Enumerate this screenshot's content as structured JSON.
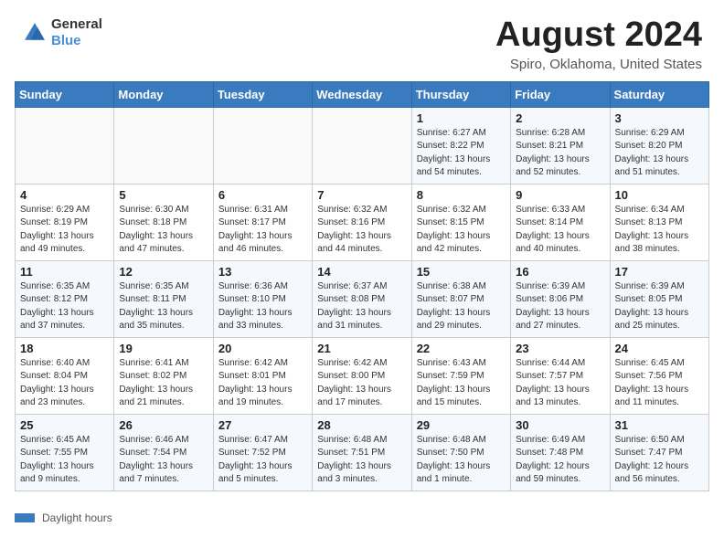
{
  "header": {
    "logo_general": "General",
    "logo_blue": "Blue",
    "month_year": "August 2024",
    "location": "Spiro, Oklahoma, United States"
  },
  "weekdays": [
    "Sunday",
    "Monday",
    "Tuesday",
    "Wednesday",
    "Thursday",
    "Friday",
    "Saturday"
  ],
  "legend": {
    "label": "Daylight hours"
  },
  "weeks": [
    [
      {
        "day": "",
        "info": ""
      },
      {
        "day": "",
        "info": ""
      },
      {
        "day": "",
        "info": ""
      },
      {
        "day": "",
        "info": ""
      },
      {
        "day": "1",
        "info": "Sunrise: 6:27 AM\nSunset: 8:22 PM\nDaylight: 13 hours and 54 minutes."
      },
      {
        "day": "2",
        "info": "Sunrise: 6:28 AM\nSunset: 8:21 PM\nDaylight: 13 hours and 52 minutes."
      },
      {
        "day": "3",
        "info": "Sunrise: 6:29 AM\nSunset: 8:20 PM\nDaylight: 13 hours and 51 minutes."
      }
    ],
    [
      {
        "day": "4",
        "info": "Sunrise: 6:29 AM\nSunset: 8:19 PM\nDaylight: 13 hours and 49 minutes."
      },
      {
        "day": "5",
        "info": "Sunrise: 6:30 AM\nSunset: 8:18 PM\nDaylight: 13 hours and 47 minutes."
      },
      {
        "day": "6",
        "info": "Sunrise: 6:31 AM\nSunset: 8:17 PM\nDaylight: 13 hours and 46 minutes."
      },
      {
        "day": "7",
        "info": "Sunrise: 6:32 AM\nSunset: 8:16 PM\nDaylight: 13 hours and 44 minutes."
      },
      {
        "day": "8",
        "info": "Sunrise: 6:32 AM\nSunset: 8:15 PM\nDaylight: 13 hours and 42 minutes."
      },
      {
        "day": "9",
        "info": "Sunrise: 6:33 AM\nSunset: 8:14 PM\nDaylight: 13 hours and 40 minutes."
      },
      {
        "day": "10",
        "info": "Sunrise: 6:34 AM\nSunset: 8:13 PM\nDaylight: 13 hours and 38 minutes."
      }
    ],
    [
      {
        "day": "11",
        "info": "Sunrise: 6:35 AM\nSunset: 8:12 PM\nDaylight: 13 hours and 37 minutes."
      },
      {
        "day": "12",
        "info": "Sunrise: 6:35 AM\nSunset: 8:11 PM\nDaylight: 13 hours and 35 minutes."
      },
      {
        "day": "13",
        "info": "Sunrise: 6:36 AM\nSunset: 8:10 PM\nDaylight: 13 hours and 33 minutes."
      },
      {
        "day": "14",
        "info": "Sunrise: 6:37 AM\nSunset: 8:08 PM\nDaylight: 13 hours and 31 minutes."
      },
      {
        "day": "15",
        "info": "Sunrise: 6:38 AM\nSunset: 8:07 PM\nDaylight: 13 hours and 29 minutes."
      },
      {
        "day": "16",
        "info": "Sunrise: 6:39 AM\nSunset: 8:06 PM\nDaylight: 13 hours and 27 minutes."
      },
      {
        "day": "17",
        "info": "Sunrise: 6:39 AM\nSunset: 8:05 PM\nDaylight: 13 hours and 25 minutes."
      }
    ],
    [
      {
        "day": "18",
        "info": "Sunrise: 6:40 AM\nSunset: 8:04 PM\nDaylight: 13 hours and 23 minutes."
      },
      {
        "day": "19",
        "info": "Sunrise: 6:41 AM\nSunset: 8:02 PM\nDaylight: 13 hours and 21 minutes."
      },
      {
        "day": "20",
        "info": "Sunrise: 6:42 AM\nSunset: 8:01 PM\nDaylight: 13 hours and 19 minutes."
      },
      {
        "day": "21",
        "info": "Sunrise: 6:42 AM\nSunset: 8:00 PM\nDaylight: 13 hours and 17 minutes."
      },
      {
        "day": "22",
        "info": "Sunrise: 6:43 AM\nSunset: 7:59 PM\nDaylight: 13 hours and 15 minutes."
      },
      {
        "day": "23",
        "info": "Sunrise: 6:44 AM\nSunset: 7:57 PM\nDaylight: 13 hours and 13 minutes."
      },
      {
        "day": "24",
        "info": "Sunrise: 6:45 AM\nSunset: 7:56 PM\nDaylight: 13 hours and 11 minutes."
      }
    ],
    [
      {
        "day": "25",
        "info": "Sunrise: 6:45 AM\nSunset: 7:55 PM\nDaylight: 13 hours and 9 minutes."
      },
      {
        "day": "26",
        "info": "Sunrise: 6:46 AM\nSunset: 7:54 PM\nDaylight: 13 hours and 7 minutes."
      },
      {
        "day": "27",
        "info": "Sunrise: 6:47 AM\nSunset: 7:52 PM\nDaylight: 13 hours and 5 minutes."
      },
      {
        "day": "28",
        "info": "Sunrise: 6:48 AM\nSunset: 7:51 PM\nDaylight: 13 hours and 3 minutes."
      },
      {
        "day": "29",
        "info": "Sunrise: 6:48 AM\nSunset: 7:50 PM\nDaylight: 13 hours and 1 minute."
      },
      {
        "day": "30",
        "info": "Sunrise: 6:49 AM\nSunset: 7:48 PM\nDaylight: 12 hours and 59 minutes."
      },
      {
        "day": "31",
        "info": "Sunrise: 6:50 AM\nSunset: 7:47 PM\nDaylight: 12 hours and 56 minutes."
      }
    ]
  ]
}
